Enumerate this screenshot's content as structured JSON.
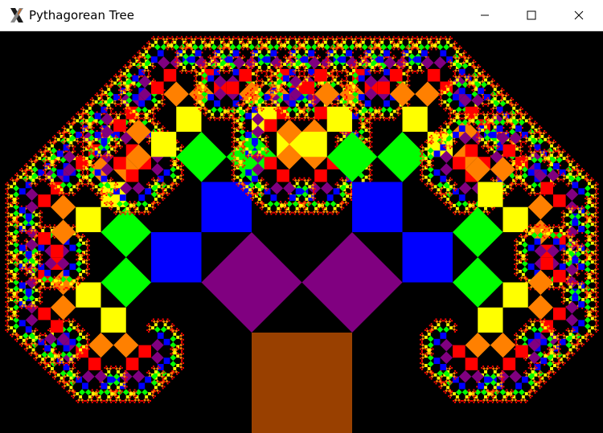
{
  "window": {
    "title": "Pythagorean Tree",
    "app_icon": "x-app-icon",
    "controls": {
      "minimize_icon": "minimize-icon",
      "maximize_icon": "maximize-icon",
      "close_icon": "close-icon"
    }
  },
  "fractal": {
    "name": "Pythagorean tree",
    "background_color": "#000000",
    "branch_angle_deg": 45,
    "depth": 12,
    "level_colors": [
      "#994000",
      "#800080",
      "#0000ff",
      "#00ff00",
      "#ffff00",
      "#ff8000",
      "#ff0000",
      "#800080",
      "#0000ff",
      "#00ff00",
      "#ffff00",
      "#ff8000",
      "#ff0000"
    ]
  }
}
